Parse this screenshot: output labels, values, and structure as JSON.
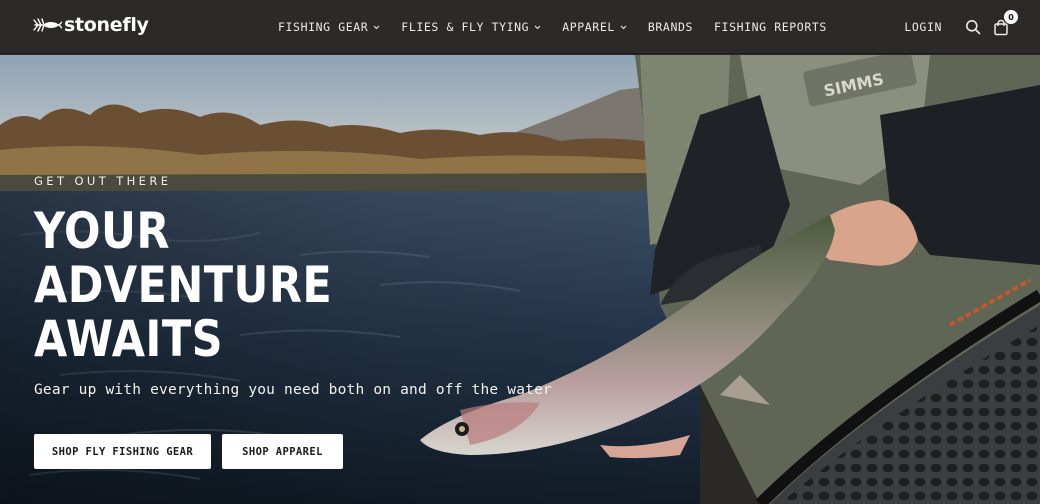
{
  "brand": {
    "name": "stonefly",
    "logo_icon": "fly-icon"
  },
  "nav": {
    "items": [
      {
        "label": "FISHING GEAR",
        "has_dropdown": true
      },
      {
        "label": "FLIES & FLY TYING",
        "has_dropdown": true
      },
      {
        "label": "APPAREL",
        "has_dropdown": true
      },
      {
        "label": "BRANDS",
        "has_dropdown": false
      },
      {
        "label": "FISHING REPORTS",
        "has_dropdown": false
      }
    ],
    "login_label": "LOGIN",
    "search_icon": "search-icon",
    "cart_icon": "shopping-bag-icon",
    "cart_count": "0"
  },
  "hero": {
    "eyebrow": "GET OUT THERE",
    "headline_line1": "YOUR ADVENTURE",
    "headline_line2": "AWAITS",
    "subline": "Gear up with everything you need both on and off the water",
    "buttons": {
      "primary_label": "SHOP FLY FISHING GEAR",
      "secondary_label": "SHOP APPAREL"
    },
    "image_description_alt": "Angler releasing a rainbow trout in a river",
    "jacket_brand_text": "SIMMS"
  },
  "colors": {
    "header_bg": "#2b2a27",
    "button_bg": "#ffffff",
    "button_text": "#1b1b1b",
    "text_light": "#ffffff"
  }
}
